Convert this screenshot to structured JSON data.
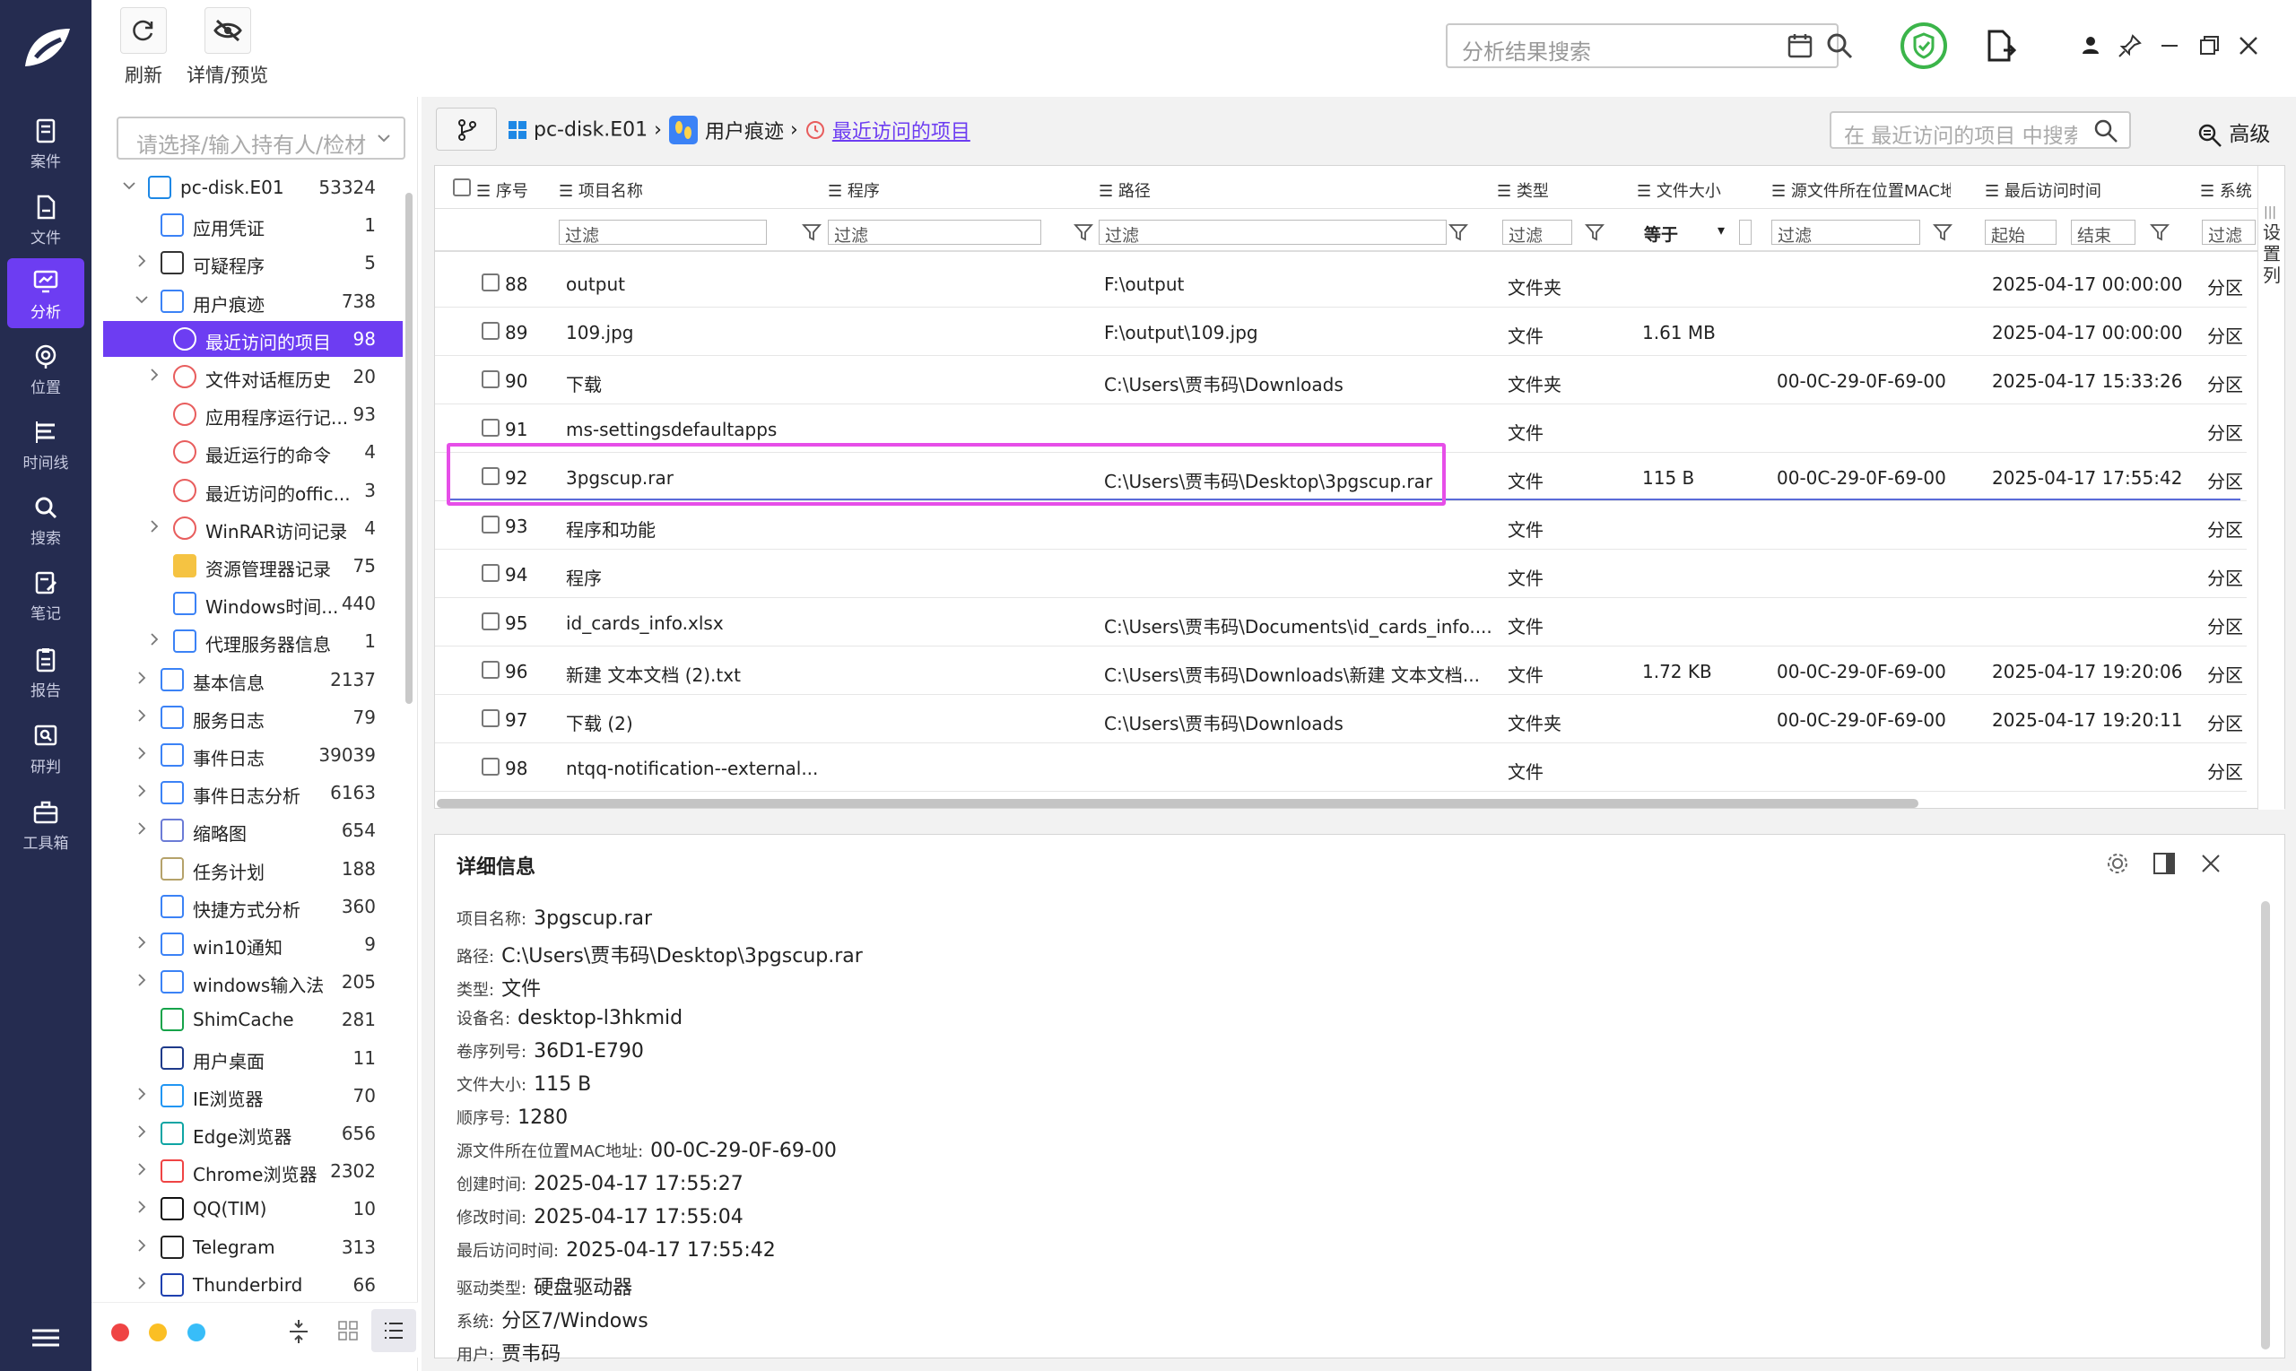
{
  "toolbar": {
    "refresh": "刷新",
    "detail_preview": "详情/预览",
    "search_placeholder": "分析结果搜索"
  },
  "nav": [
    {
      "label": "案件",
      "icon": "case-icon"
    },
    {
      "label": "文件",
      "icon": "file-icon"
    },
    {
      "label": "分析",
      "icon": "analysis-icon"
    },
    {
      "label": "位置",
      "icon": "location-icon"
    },
    {
      "label": "时间线",
      "icon": "timeline-icon"
    },
    {
      "label": "搜索",
      "icon": "search-icon"
    },
    {
      "label": "笔记",
      "icon": "note-icon"
    },
    {
      "label": "报告",
      "icon": "report-icon"
    },
    {
      "label": "研判",
      "icon": "judge-icon"
    },
    {
      "label": "工具箱",
      "icon": "toolbox-icon"
    }
  ],
  "tree": {
    "select_placeholder": "请选择/输入持有人/检材",
    "items": [
      {
        "label": "pc-disk.E01",
        "count": "53324"
      },
      {
        "label": "应用凭证",
        "count": "1"
      },
      {
        "label": "可疑程序",
        "count": "5"
      },
      {
        "label": "用户痕迹",
        "count": "738"
      },
      {
        "label": "最近访问的项目",
        "count": "98"
      },
      {
        "label": "文件对话框历史",
        "count": "20"
      },
      {
        "label": "应用程序运行记...",
        "count": "93"
      },
      {
        "label": "最近运行的命令",
        "count": "4"
      },
      {
        "label": "最近访问的offic...",
        "count": "3"
      },
      {
        "label": "WinRAR访问记录",
        "count": "4"
      },
      {
        "label": "资源管理器记录",
        "count": "75"
      },
      {
        "label": "Windows时间...",
        "count": "440"
      },
      {
        "label": "代理服务器信息",
        "count": "1"
      },
      {
        "label": "基本信息",
        "count": "2137"
      },
      {
        "label": "服务日志",
        "count": "79"
      },
      {
        "label": "事件日志",
        "count": "39039"
      },
      {
        "label": "事件日志分析",
        "count": "6163"
      },
      {
        "label": "缩略图",
        "count": "654"
      },
      {
        "label": "任务计划",
        "count": "188"
      },
      {
        "label": "快捷方式分析",
        "count": "360"
      },
      {
        "label": "win10通知",
        "count": "9"
      },
      {
        "label": "windows输入法",
        "count": "205"
      },
      {
        "label": "ShimCache",
        "count": "281"
      },
      {
        "label": "用户桌面",
        "count": "11"
      },
      {
        "label": "IE浏览器",
        "count": "70"
      },
      {
        "label": "Edge浏览器",
        "count": "656"
      },
      {
        "label": "Chrome浏览器",
        "count": "2302"
      },
      {
        "label": "QQ(TIM)",
        "count": "10"
      },
      {
        "label": "Telegram",
        "count": "313"
      },
      {
        "label": "Thunderbird",
        "count": "66"
      }
    ]
  },
  "breadcrumb": {
    "disk": "pc-disk.E01",
    "sep": "›",
    "trace": "用户痕迹",
    "current": "最近访问的项目",
    "search_placeholder": "在 最近访问的项目 中搜索",
    "advanced": "高级"
  },
  "grid": {
    "headers": [
      "序号",
      "项目名称",
      "程序",
      "路径",
      "类型",
      "文件大小",
      "源文件所在位置MAC地址",
      "最后访问时间",
      "系统"
    ],
    "filter_text": "过滤",
    "size_op": "等于",
    "date_start": "起始",
    "date_end": "结束",
    "settings_col": "设置列",
    "rows": [
      {
        "no": "88",
        "name": "output",
        "path": "F:\\output",
        "type": "文件夹",
        "size": "",
        "mac": "",
        "time": "2025-04-17 00:00:00",
        "sys": "分区"
      },
      {
        "no": "89",
        "name": "109.jpg",
        "path": "F:\\output\\109.jpg",
        "type": "文件",
        "size": "1.61 MB",
        "mac": "",
        "time": "2025-04-17 00:00:00",
        "sys": "分区"
      },
      {
        "no": "90",
        "name": "下载",
        "path": "C:\\Users\\贾韦码\\Downloads",
        "type": "文件夹",
        "size": "",
        "mac": "00-0C-29-0F-69-00",
        "time": "2025-04-17 15:33:26",
        "sys": "分区"
      },
      {
        "no": "91",
        "name": "ms-settingsdefaultapps",
        "path": "",
        "type": "文件",
        "size": "",
        "mac": "",
        "time": "",
        "sys": "分区"
      },
      {
        "no": "92",
        "name": "3pgscup.rar",
        "path": "C:\\Users\\贾韦码\\Desktop\\3pgscup.rar",
        "type": "文件",
        "size": "115 B",
        "mac": "00-0C-29-0F-69-00",
        "time": "2025-04-17 17:55:42",
        "sys": "分区"
      },
      {
        "no": "93",
        "name": "程序和功能",
        "path": "",
        "type": "文件",
        "size": "",
        "mac": "",
        "time": "",
        "sys": "分区"
      },
      {
        "no": "94",
        "name": "程序",
        "path": "",
        "type": "文件",
        "size": "",
        "mac": "",
        "time": "",
        "sys": "分区"
      },
      {
        "no": "95",
        "name": "id_cards_info.xlsx",
        "path": "C:\\Users\\贾韦码\\Documents\\id_cards_info....",
        "type": "文件",
        "size": "",
        "mac": "",
        "time": "",
        "sys": "分区"
      },
      {
        "no": "96",
        "name": "新建 文本文档 (2).txt",
        "path": "C:\\Users\\贾韦码\\Downloads\\新建 文本文档...",
        "type": "文件",
        "size": "1.72 KB",
        "mac": "00-0C-29-0F-69-00",
        "time": "2025-04-17 19:20:06",
        "sys": "分区"
      },
      {
        "no": "97",
        "name": "下载 (2)",
        "path": "C:\\Users\\贾韦码\\Downloads",
        "type": "文件夹",
        "size": "",
        "mac": "00-0C-29-0F-69-00",
        "time": "2025-04-17 19:20:11",
        "sys": "分区"
      },
      {
        "no": "98",
        "name": "ntqq-notification--external...",
        "path": "",
        "type": "文件",
        "size": "",
        "mac": "",
        "time": "",
        "sys": "分区"
      }
    ]
  },
  "detail": {
    "title": "详细信息",
    "fields": [
      {
        "label": "项目名称:",
        "value": "3pgscup.rar"
      },
      {
        "label": "路径:",
        "value": "C:\\Users\\贾韦码\\Desktop\\3pgscup.rar"
      },
      {
        "label": "类型:",
        "value": "文件"
      },
      {
        "label": "设备名:",
        "value": "desktop-l3hkmid"
      },
      {
        "label": "卷序列号:",
        "value": "36D1-E790"
      },
      {
        "label": "文件大小:",
        "value": "115 B"
      },
      {
        "label": "顺序号:",
        "value": "1280"
      },
      {
        "label": "源文件所在位置MAC地址:",
        "value": "00-0C-29-0F-69-00"
      },
      {
        "label": "创建时间:",
        "value": "2025-04-17 17:55:27"
      },
      {
        "label": "修改时间:",
        "value": "2025-04-17 17:55:04"
      },
      {
        "label": "最后访问时间:",
        "value": "2025-04-17 17:55:42"
      },
      {
        "label": "驱动类型:",
        "value": "硬盘驱动器"
      },
      {
        "label": "系统:",
        "value": "分区7/Windows"
      },
      {
        "label": "用户:",
        "value": "贾韦码"
      }
    ]
  }
}
